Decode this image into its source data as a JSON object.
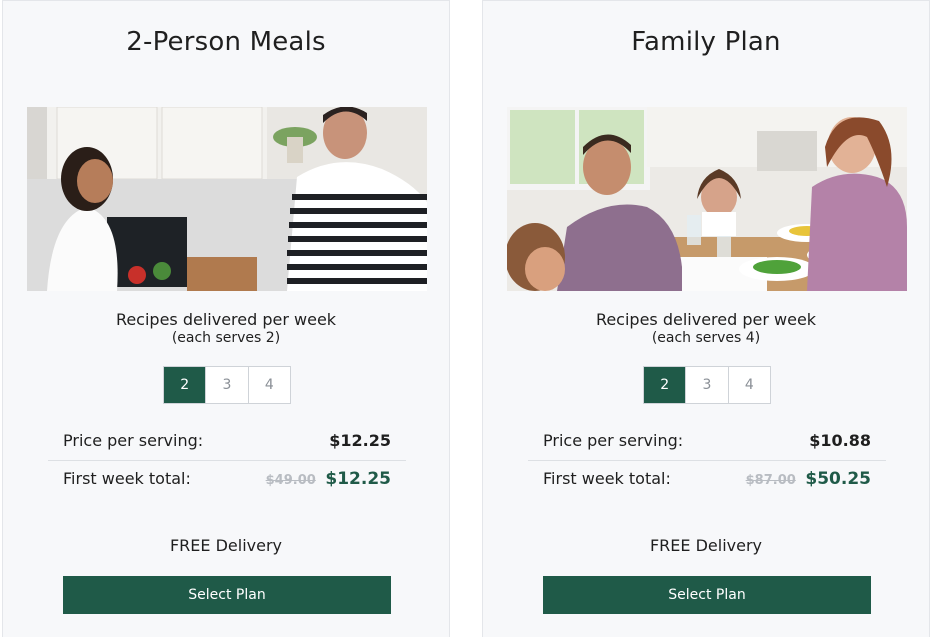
{
  "plans": [
    {
      "title": "2-Person Meals",
      "image_alt": "couple in kitchen with meal kit",
      "recipes_label": "Recipes delivered per week",
      "serves_label": "(each serves 2)",
      "options": [
        "2",
        "3",
        "4"
      ],
      "selected_option": "2",
      "price_label": "Price per serving:",
      "price_value": "$12.25",
      "first_week_label": "First week total:",
      "first_week_original": "$49.00",
      "first_week_value": "$12.25",
      "delivery_label": "FREE Delivery",
      "cta_label": "Select Plan"
    },
    {
      "title": "Family Plan",
      "image_alt": "family eating dinner at table",
      "recipes_label": "Recipes delivered per week",
      "serves_label": "(each serves 4)",
      "options": [
        "2",
        "3",
        "4"
      ],
      "selected_option": "2",
      "price_label": "Price per serving:",
      "price_value": "$10.88",
      "first_week_label": "First week total:",
      "first_week_original": "$87.00",
      "first_week_value": "$50.25",
      "delivery_label": "FREE Delivery",
      "cta_label": "Select Plan"
    }
  ],
  "colors": {
    "accent": "#1f5a48",
    "card_bg": "#f7f8fa",
    "strike": "#b8bcc2"
  }
}
